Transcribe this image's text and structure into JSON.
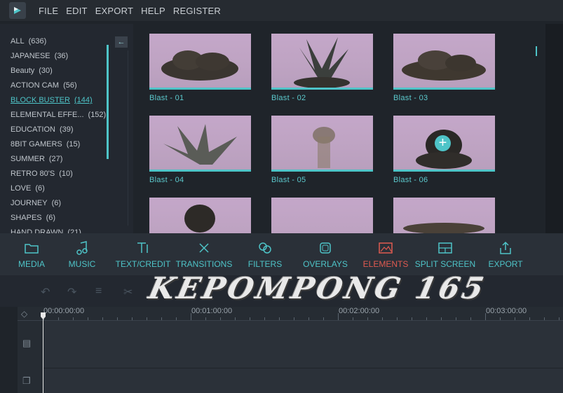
{
  "menu": [
    "FILE",
    "EDIT",
    "EXPORT",
    "HELP",
    "REGISTER"
  ],
  "categories": [
    {
      "name": "ALL",
      "count": "(636)"
    },
    {
      "name": "JAPANESE",
      "count": "(36)"
    },
    {
      "name": "Beauty",
      "count": "(30)"
    },
    {
      "name": "ACTION CAM",
      "count": "(56)"
    },
    {
      "name": "BLOCK BUSTER",
      "count": "(144)"
    },
    {
      "name": "ELEMENTAL EFFE...",
      "count": "(152)"
    },
    {
      "name": "EDUCATION",
      "count": "(39)"
    },
    {
      "name": "8BIT GAMERS",
      "count": "(15)"
    },
    {
      "name": "SUMMER",
      "count": "(27)"
    },
    {
      "name": "RETRO 80'S",
      "count": "(10)"
    },
    {
      "name": "LOVE",
      "count": "(6)"
    },
    {
      "name": "JOURNEY",
      "count": "(6)"
    },
    {
      "name": "SHAPES",
      "count": "(6)"
    },
    {
      "name": "HAND DRAWN",
      "count": "(21)"
    }
  ],
  "active_category": "BLOCK BUSTER",
  "thumbnails": [
    {
      "label": "Blast - 01"
    },
    {
      "label": "Blast - 02"
    },
    {
      "label": "Blast - 03"
    },
    {
      "label": "Blast - 04"
    },
    {
      "label": "Blast - 05"
    },
    {
      "label": "Blast - 06"
    },
    {
      "label": ""
    },
    {
      "label": ""
    },
    {
      "label": ""
    }
  ],
  "toolbar": {
    "tabs": [
      {
        "label": "MEDIA",
        "icon": "folder-icon"
      },
      {
        "label": "MUSIC",
        "icon": "music-note-icon"
      },
      {
        "label": "TEXT/CREDIT",
        "icon": "text-icon"
      },
      {
        "label": "TRANSITIONS",
        "icon": "transitions-icon"
      },
      {
        "label": "FILTERS",
        "icon": "filters-icon"
      },
      {
        "label": "OVERLAYS",
        "icon": "overlays-icon"
      },
      {
        "label": "ELEMENTS",
        "icon": "elements-icon"
      },
      {
        "label": "SPLIT SCREEN",
        "icon": "split-screen-icon"
      },
      {
        "label": "EXPORT",
        "icon": "export-icon"
      }
    ],
    "active": "ELEMENTS"
  },
  "watermark": "KEPOMPONG 165",
  "timeline": {
    "timecodes": [
      "00:00:00:00",
      "00:01:00:00",
      "00:02:00:00",
      "00:03:00:00"
    ]
  },
  "colors": {
    "accent": "#4ec4c8",
    "active_tab": "#e05a50",
    "background": "#1f242a"
  }
}
